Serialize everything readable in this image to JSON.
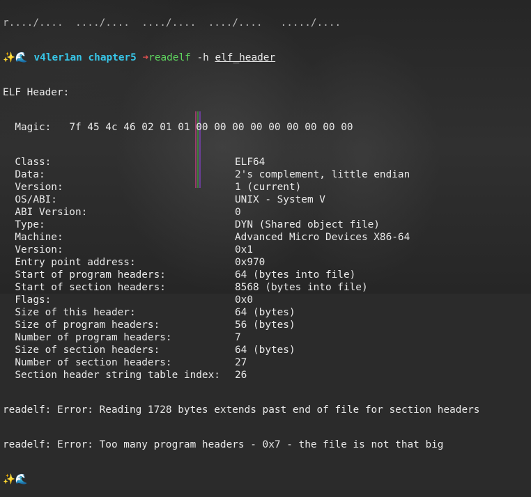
{
  "prompt": {
    "top_cut_line": "r..../....  ..../....  ..../....  ..../....   ...../....",
    "user": "v4ler1an",
    "dir": "chapter5",
    "arrow": "➜",
    "command": "readelf",
    "flag": "-h",
    "file": "elf_header"
  },
  "title_line": "ELF Header:",
  "magic_label": "  Magic:   ",
  "magic_value": "7f 45 4c 46 02 01 01 00 00 00 00 00 00 00 00 00",
  "fields": [
    {
      "k": "  Class:",
      "v": "ELF64"
    },
    {
      "k": "  Data:",
      "v": "2's complement, little endian"
    },
    {
      "k": "  Version:",
      "v": "1 (current)"
    },
    {
      "k": "  OS/ABI:",
      "v": "UNIX - System V"
    },
    {
      "k": "  ABI Version:",
      "v": "0"
    },
    {
      "k": "  Type:",
      "v": "DYN (Shared object file)"
    },
    {
      "k": "  Machine:",
      "v": "Advanced Micro Devices X86-64"
    },
    {
      "k": "  Version:",
      "v": "0x1"
    },
    {
      "k": "  Entry point address:",
      "v": "0x970"
    },
    {
      "k": "  Start of program headers:",
      "v": "64 (bytes into file)"
    },
    {
      "k": "  Start of section headers:",
      "v": "8568 (bytes into file)"
    },
    {
      "k": "  Flags:",
      "v": "0x0"
    },
    {
      "k": "  Size of this header:",
      "v": "64 (bytes)"
    },
    {
      "k": "  Size of program headers:",
      "v": "56 (bytes)"
    },
    {
      "k": "  Number of program headers:",
      "v": "7"
    },
    {
      "k": "  Size of section headers:",
      "v": "64 (bytes)"
    },
    {
      "k": "  Number of section headers:",
      "v": "27"
    },
    {
      "k": "  Section header string table index:",
      "v": "26"
    }
  ],
  "errors": [
    "readelf: Error: Reading 1728 bytes extends past end of file for section headers",
    "readelf: Error: Too many program headers - 0x7 - the file is not that big"
  ],
  "icons": {
    "sparkle": "sparkles-icon",
    "wave": "wave-icon"
  },
  "colors": {
    "accent": "#37c6e8",
    "command": "#5fd75f",
    "arrow": "#e05050",
    "text": "#e8e8e8"
  }
}
